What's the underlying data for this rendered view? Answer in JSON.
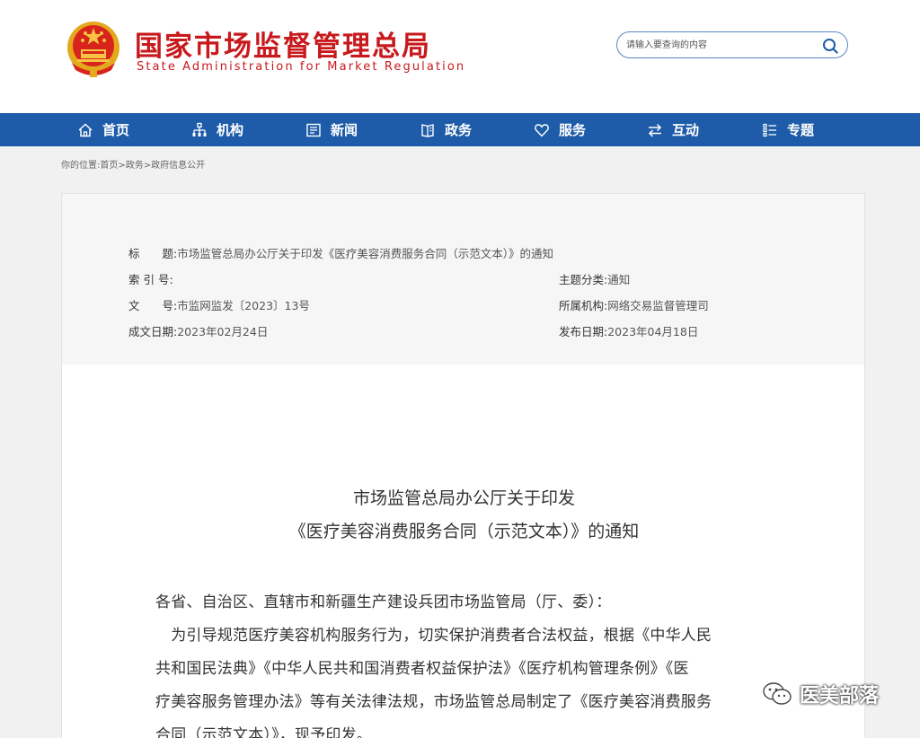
{
  "header": {
    "logo_cn": "国家市场监督管理总局",
    "logo_en": "State Administration for Market Regulation"
  },
  "search": {
    "placeholder": "请输入要查询的内容"
  },
  "nav": {
    "items": [
      {
        "label": "首页",
        "icon": "home-icon"
      },
      {
        "label": "机构",
        "icon": "org-chart-icon"
      },
      {
        "label": "新闻",
        "icon": "news-icon"
      },
      {
        "label": "政务",
        "icon": "book-icon"
      },
      {
        "label": "服务",
        "icon": "heart-icon"
      },
      {
        "label": "互动",
        "icon": "exchange-icon"
      },
      {
        "label": "专题",
        "icon": "list-icon"
      }
    ]
  },
  "breadcrumb": "你的位置:首页>政务>政府信息公开",
  "meta": {
    "title_label": "标　　题:",
    "title_value": "市场监管总局办公厅关于印发《医疗美容消费服务合同（示范文本）》的通知",
    "index_label": "索 引 号:",
    "index_value": "",
    "topic_label": "主题分类:",
    "topic_value": "通知",
    "docno_label": "文　　号:",
    "docno_value": "市监网监发〔2023〕13号",
    "dept_label": "所属机构:",
    "dept_value": "网络交易监督管理司",
    "created_label": "成文日期:",
    "created_value": "2023年02月24日",
    "published_label": "发布日期:",
    "published_value": "2023年04月18日"
  },
  "doc": {
    "title_line1": "市场监管总局办公厅关于印发",
    "title_line2": "《医疗美容消费服务合同（示范文本）》的通知",
    "lines": [
      "各省、自治区、直辖市和新疆生产建设兵团市场监管局（厅、委）：",
      "　为引导规范医疗美容机构服务行为，切实保护消费者合法权益，根据《中华人民",
      "共和国民法典》《中华人民共和国消费者权益保护法》《医疗机构管理条例》《医",
      "疗美容服务管理办法》等有关法律法规，市场监管总局制定了《医疗美容消费服务",
      "合同（示范文本）》，现予印发。"
    ]
  },
  "watermark": {
    "text": "医美部落",
    "icon": "wechat-icon"
  },
  "colors": {
    "brand_red": "#c8191d",
    "nav_blue": "#1e5ba8"
  }
}
